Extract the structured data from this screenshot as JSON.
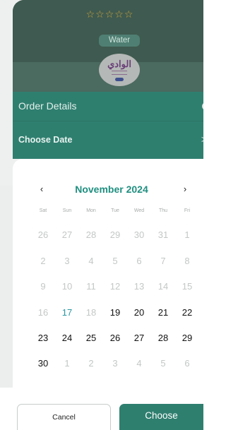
{
  "product": {
    "rating_stars": "☆☆☆☆☆",
    "category_chip": "Water",
    "logo_text": "الوادي"
  },
  "order_details": {
    "title": "Order Details"
  },
  "choose_date": {
    "title": "Choose Date",
    "arrow": ">"
  },
  "calendar": {
    "prev": "‹",
    "next": "›",
    "month_label": "November 2024",
    "weekdays": [
      "Sat",
      "Sun",
      "Mon",
      "Tue",
      "Wed",
      "Thu",
      "Fri"
    ],
    "today": "17",
    "weeks": [
      [
        "26",
        "27",
        "28",
        "29",
        "30",
        "31",
        "1"
      ],
      [
        "2",
        "3",
        "4",
        "5",
        "6",
        "7",
        "8"
      ],
      [
        "9",
        "10",
        "11",
        "12",
        "13",
        "14",
        "15"
      ],
      [
        "16",
        "17",
        "18",
        "19",
        "20",
        "21",
        "22"
      ],
      [
        "23",
        "24",
        "25",
        "26",
        "27",
        "28",
        "29"
      ],
      [
        "30",
        "1",
        "2",
        "3",
        "4",
        "5",
        "6"
      ]
    ]
  },
  "actions": {
    "cancel_label": "Cancel",
    "choose_label": "Choose"
  },
  "colors": {
    "accent": "#2f7f6f",
    "month": "#1f8f80",
    "today": "#2a96a2",
    "disabled": "#c3c7c6"
  }
}
